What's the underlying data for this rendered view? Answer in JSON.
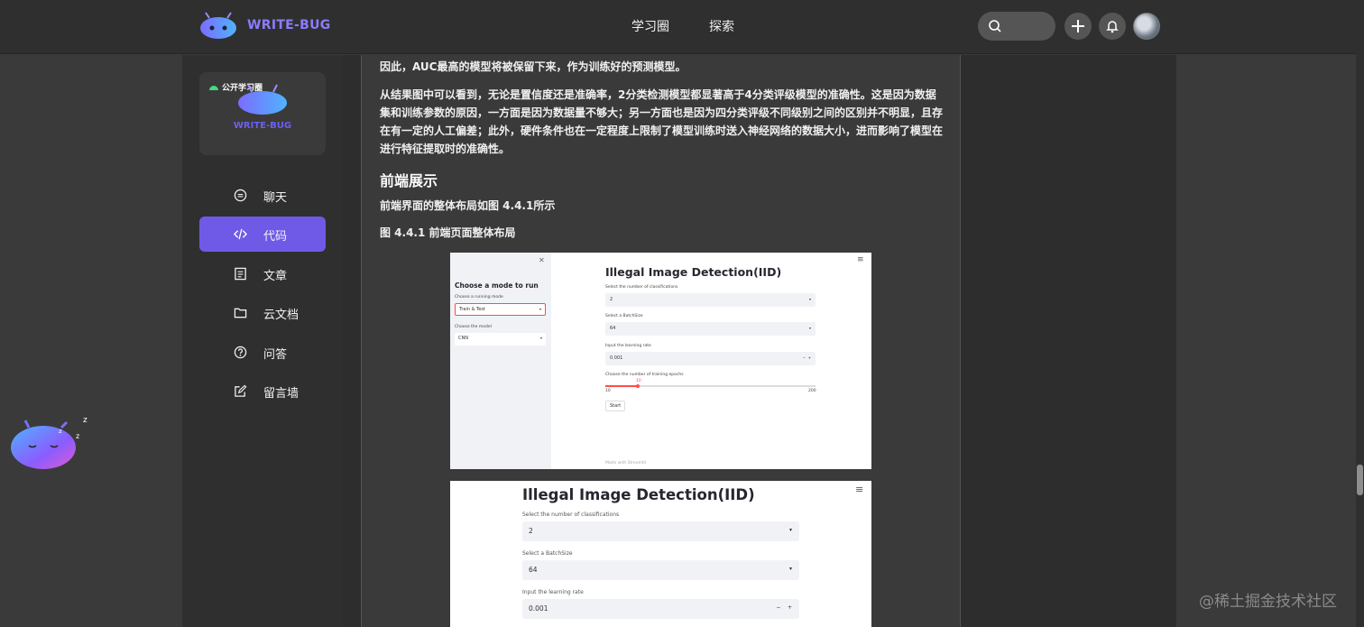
{
  "header": {
    "logo_text": "WRITE-BUG",
    "nav": [
      "学习圈",
      "探索"
    ]
  },
  "sidebar": {
    "circle_card": {
      "tag": "公开学习圈",
      "brand": "WRITE-BUG"
    },
    "items": [
      {
        "label": "聊天",
        "icon": "chat-icon",
        "active": false
      },
      {
        "label": "代码",
        "icon": "code-icon",
        "active": true
      },
      {
        "label": "文章",
        "icon": "article-icon",
        "active": false
      },
      {
        "label": "云文档",
        "icon": "folder-icon",
        "active": false
      },
      {
        "label": "问答",
        "icon": "question-icon",
        "active": false
      },
      {
        "label": "留言墙",
        "icon": "edit-icon",
        "active": false
      }
    ]
  },
  "article": {
    "p1": "因此，AUC最高的模型将被保留下来，作为训练好的预测模型。",
    "p2": "从结果图中可以看到，无论是置信度还是准确率，2分类检测模型都显著高于4分类评级模型的准确性。这是因为数据集和训练参数的原因，一方面是因为数据量不够大；另一方面也是因为四分类评级不同级别之间的区别并不明显，且存在有一定的人工偏差；此外，硬件条件也在一定程度上限制了模型训练时送入神经网络的数据大小，进而影响了模型在进行特征提取时的准确性。",
    "h2": "前端展示",
    "p3": "前端界面的整体布局如图 4.4.1所示",
    "caption": "图 4.4.1 前端页面整体布局"
  },
  "screenshot1": {
    "side_title": "Choose a mode to run",
    "mode_label": "Choose a running mode",
    "mode_value": "Train & Test",
    "model_label": "Choose the model",
    "model_value": "CNN",
    "title": "Illegal Image Detection(IID)",
    "class_label": "Select the number of classifications",
    "class_value": "2",
    "batch_label": "Select a BatchSize",
    "batch_value": "64",
    "lr_label": "Input the learning rate",
    "lr_value": "0.001",
    "epoch_label": "Choose the number of training epochs",
    "epoch_value": "10",
    "epoch_min": "10",
    "epoch_max": "200",
    "start": "Start",
    "footer": "Made with Streamlit"
  },
  "screenshot2": {
    "title": "Illegal Image Detection(IID)",
    "class_label": "Select the number of classifications",
    "class_value": "2",
    "batch_label": "Select a BatchSize",
    "batch_value": "64",
    "lr_label": "Input the learning rate",
    "lr_value": "0.001"
  },
  "watermark": "@稀土掘金技术社区",
  "colors": {
    "accent": "#6e5ae6",
    "brand": "#8b7cff",
    "streamlit_red": "#ff4b4b"
  }
}
